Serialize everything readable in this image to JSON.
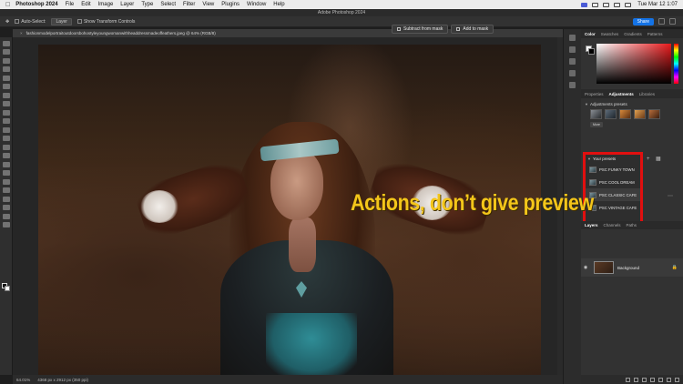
{
  "menubar": {
    "app": "Photoshop 2024",
    "items": [
      "File",
      "Edit",
      "Image",
      "Layer",
      "Type",
      "Select",
      "Filter",
      "View",
      "Plugins",
      "Window",
      "Help"
    ],
    "clock": "Tue Mar 12  1:07"
  },
  "window": {
    "title": "Adobe Photoshop 2024"
  },
  "options": {
    "auto_select": "Auto-Select:",
    "layer_dropdown": "Layer",
    "transform_controls": "Show Transform Controls",
    "share": "Share"
  },
  "mask_buttons": {
    "subtract": "Subtract from mask",
    "add": "Add to mask"
  },
  "document": {
    "tab_title": "fashionmodelportraitoutdoorsbohostyleyoungwomanwithheaddressmadeoffeathers.jpeg @ 64% (RGB/8)"
  },
  "statusbar": {
    "zoom": "64.01%",
    "doc_info": "4368 px x 2912 px (350 ppi)"
  },
  "overlay": {
    "text": "Actions, don’t give preview",
    "color": "#f4c61a"
  },
  "color_panel": {
    "tabs": [
      "Color",
      "Swatches",
      "Gradients",
      "Patterns"
    ]
  },
  "adjustments_panel": {
    "tabs": [
      "Properties",
      "Adjustments",
      "Libraries"
    ],
    "presets_heading": "Adjustments presets",
    "more": "More",
    "your_presets_heading": "Your presets",
    "presets": [
      {
        "label": "PSC FUNKY TOWN"
      },
      {
        "label": "PSC COOL DREAM"
      },
      {
        "label": "PSC CLASSIC CAFE"
      },
      {
        "label": "PSC VINTAGE CAFE"
      }
    ],
    "highlight_color": "#e10f0f"
  },
  "layers_panel": {
    "tabs": [
      "Layers",
      "Channels",
      "Paths"
    ],
    "layers": [
      {
        "name": "Background"
      }
    ]
  }
}
